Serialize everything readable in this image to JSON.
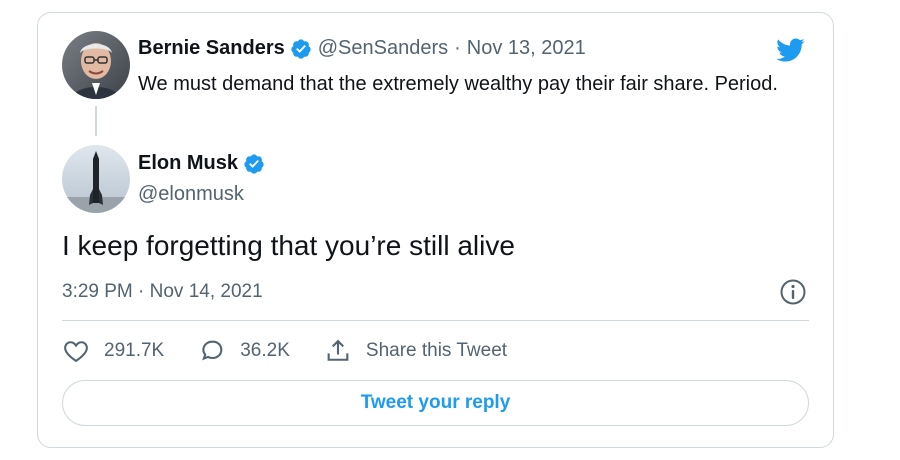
{
  "parent_tweet": {
    "author_name": "Bernie Sanders",
    "handle": "@SenSanders",
    "separator": "·",
    "date": "Nov 13, 2021",
    "text": "We must demand that the extremely wealthy pay their fair share. Period."
  },
  "main_tweet": {
    "author_name": "Elon Musk",
    "handle": "@elonmusk",
    "text": "I keep forgetting that you’re still alive",
    "timestamp": "3:29 PM · Nov 14, 2021"
  },
  "actions": {
    "likes": "291.7K",
    "replies": "36.2K",
    "share_label": "Share this Tweet"
  },
  "reply_button_label": "Tweet your reply",
  "colors": {
    "accent": "#1d9bf0",
    "muted": "#536471",
    "border": "#cfd9de"
  }
}
